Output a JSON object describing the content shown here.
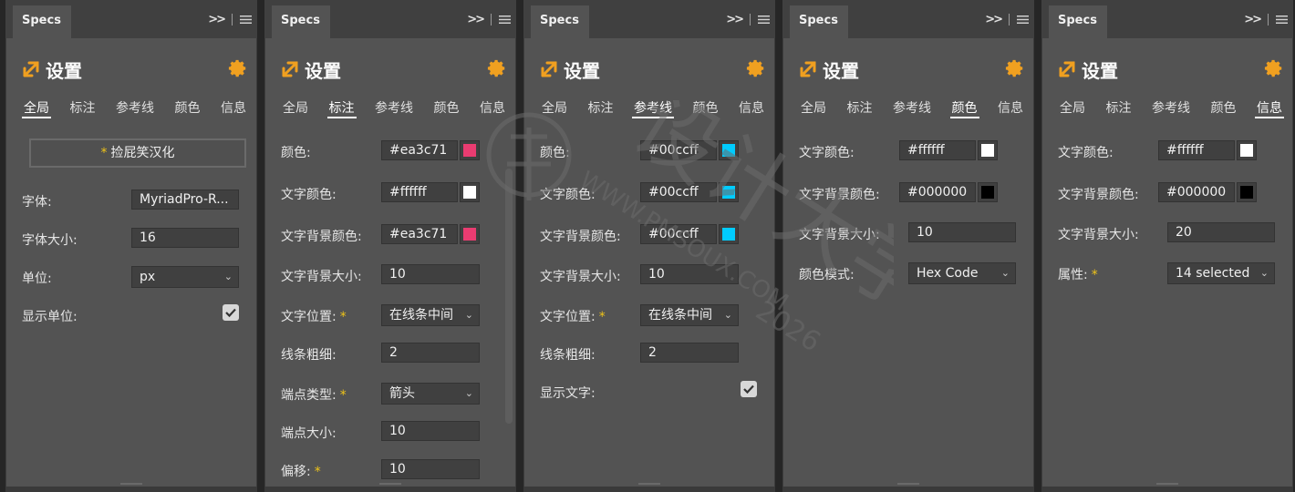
{
  "colors": {
    "accent": "#f0a020",
    "star": "#f0c419",
    "pink": "#ea3c71",
    "cyan": "#00ccff",
    "white": "#ffffff",
    "black": "#000000"
  },
  "panels": [
    {
      "tab": "Specs",
      "title": "设置",
      "subtabs": [
        "全局",
        "标注",
        "参考线",
        "颜色",
        "信息"
      ],
      "active": 0,
      "button": "捡屁笑汉化",
      "button_star": "*",
      "rows": [
        {
          "label": "字体:",
          "value": "MyriadPro-R..."
        },
        {
          "label": "字体大小:",
          "value": "16"
        },
        {
          "label": "单位:",
          "value": "px"
        },
        {
          "label": "显示单位:"
        }
      ]
    },
    {
      "tab": "Specs",
      "title": "设置",
      "subtabs": [
        "全局",
        "标注",
        "参考线",
        "颜色",
        "信息"
      ],
      "active": 1,
      "rows": [
        {
          "label": "颜色:",
          "value": "#ea3c71"
        },
        {
          "label": "文字颜色:",
          "value": "#ffffff"
        },
        {
          "label": "文字背景颜色:",
          "value": "#ea3c71"
        },
        {
          "label": "文字背景大小:",
          "value": "10"
        },
        {
          "label": "文字位置:",
          "star": "*",
          "value": "在线条中间"
        },
        {
          "label": "线条粗细:",
          "value": "2"
        },
        {
          "label": "端点类型:",
          "star": "*",
          "value": "箭头"
        },
        {
          "label": "端点大小:",
          "value": "10"
        },
        {
          "label": "偏移:",
          "star": "*",
          "value": "10"
        }
      ]
    },
    {
      "tab": "Specs",
      "title": "设置",
      "subtabs": [
        "全局",
        "标注",
        "参考线",
        "颜色",
        "信息"
      ],
      "active": 2,
      "rows": [
        {
          "label": "颜色:",
          "value": "#00ccff"
        },
        {
          "label": "文字颜色:",
          "value": "#00ccff"
        },
        {
          "label": "文字背景颜色:",
          "value": "#00ccff"
        },
        {
          "label": "文字背景大小:",
          "value": "10"
        },
        {
          "label": "文字位置:",
          "star": "*",
          "value": "在线条中间"
        },
        {
          "label": "线条粗细:",
          "value": "2"
        },
        {
          "label": "显示文字:"
        }
      ]
    },
    {
      "tab": "Specs",
      "title": "设置",
      "subtabs": [
        "全局",
        "标注",
        "参考线",
        "颜色",
        "信息"
      ],
      "active": 3,
      "rows": [
        {
          "label": "文字颜色:",
          "value": "#ffffff"
        },
        {
          "label": "文字背景颜色:",
          "value": "#000000"
        },
        {
          "label": "文字背景大小:",
          "value": "10"
        },
        {
          "label": "颜色模式:",
          "value": "Hex Code"
        }
      ]
    },
    {
      "tab": "Specs",
      "title": "设置",
      "subtabs": [
        "全局",
        "标注",
        "参考线",
        "颜色",
        "信息"
      ],
      "active": 4,
      "rows": [
        {
          "label": "文字颜色:",
          "value": "#ffffff"
        },
        {
          "label": "文字背景颜色:",
          "value": "#000000"
        },
        {
          "label": "文字背景大小:",
          "value": "20"
        },
        {
          "label": "属性:",
          "star": "*",
          "value": "14 selected"
        }
      ]
    }
  ],
  "watermark": {
    "brand": "设计大学",
    "url": "WWW.PMSOUX.COM",
    "year": "2026"
  }
}
